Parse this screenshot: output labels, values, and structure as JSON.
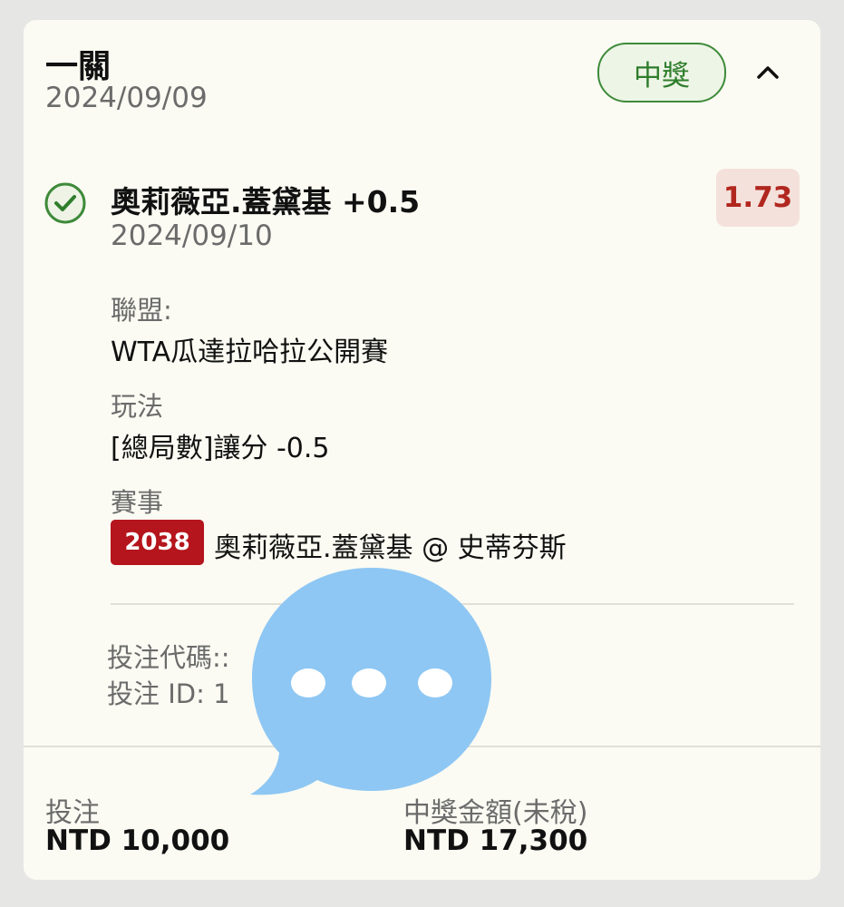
{
  "bet": {
    "title": "一關",
    "date": "2024/09/09",
    "status": "中獎",
    "collapse_icon": "chevron-up-icon"
  },
  "selection": {
    "status_icon": "check-circle-icon",
    "name": "奧莉薇亞.蓋黛基 +0.5",
    "date": "2024/09/10",
    "odds": "1.73",
    "league_label": "聯盟:",
    "league": "WTA瓜達拉哈拉公開賽",
    "market_label": "玩法",
    "market": "[總局數]讓分 -0.5",
    "event_label": "賽事",
    "event_code": "2038",
    "event_name": "奧莉薇亞.蓋黛基 @ 史蒂芬斯"
  },
  "meta": {
    "bet_code": "投注代碼::",
    "bet_id": "投注 ID: 1"
  },
  "footer": {
    "stake_label": "投注",
    "stake_value": "NTD 10,000",
    "payout_label": "中獎金額(未稅)",
    "payout_value": "NTD 17,300"
  },
  "overlay": {
    "icon": "chat-bubble-icon"
  },
  "colors": {
    "win_green": "#2f7d2c",
    "odds_red": "#b1271f",
    "event_red": "#b5151c",
    "bubble_blue": "#8ec7f3"
  }
}
